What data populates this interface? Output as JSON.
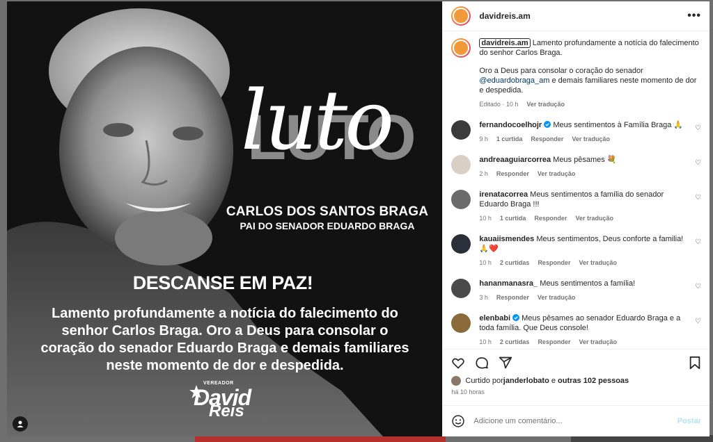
{
  "post": {
    "headline_bg": "LUTO",
    "headline_script": "luto",
    "name": "CARLOS DOS SANTOS BRAGA",
    "subname": "PAI DO SENADOR EDUARDO BRAGA",
    "rip": "DESCANSE EM PAZ!",
    "message": "Lamento profundamente a notícia do falecimento do senhor Carlos Braga. Oro a Deus para consolar o coração do senador Eduardo Braga e demais familiares neste momento de dor e despedida.",
    "logo_small": "VEREADOR",
    "logo_line1": "David",
    "logo_line2": "Reis"
  },
  "header": {
    "username": "davidreis.am",
    "more": "•••"
  },
  "caption": {
    "username": "davidreis.am",
    "text1": " Lamento profundamente a notícia do falecimento do senhor Carlos Braga.",
    "text2a": "Oro a Deus para consolar o coração do senador ",
    "mention": "@eduardobraga_am",
    "text2b": " e demais familiares neste momento de dor e despedida.",
    "edited": "Editado · 10 h",
    "translate": "Ver tradução"
  },
  "comments": [
    {
      "user": "fernandocoelhojr",
      "verified": true,
      "text": "Meus sentimentos à Família Braga 🙏",
      "time": "9 h",
      "likes": "1 curtida",
      "reply": "Responder",
      "translate": "Ver tradução",
      "avatar_color": "#3b3b3b"
    },
    {
      "user": "andreaaguiarcorrea",
      "verified": false,
      "text": "Meus pêsames 💐",
      "time": "2 h",
      "likes": "",
      "reply": "Responder",
      "translate": "Ver tradução",
      "avatar_color": "#d9cfc4"
    },
    {
      "user": "irenatacorrea",
      "verified": false,
      "text": "Meus sentimentos a família do senador Eduardo Braga !!!",
      "time": "10 h",
      "likes": "1 curtida",
      "reply": "Responder",
      "translate": "Ver tradução",
      "avatar_color": "#6b6b6b"
    },
    {
      "user": "kauaiismendes",
      "verified": false,
      "text": "Meus sentimentos, Deus conforte a familia! 🙏❤️",
      "time": "10 h",
      "likes": "2 curtidas",
      "reply": "Responder",
      "translate": "Ver tradução",
      "avatar_color": "#2b2f3a"
    },
    {
      "user": "hananmanasra_",
      "verified": false,
      "text": "Meus sentimentos a família!",
      "time": "3 h",
      "likes": "",
      "reply": "Responder",
      "translate": "Ver tradução",
      "avatar_color": "#4a4a4a"
    },
    {
      "user": "elenbabi",
      "verified": true,
      "text": "Meus pêsames ao senador Eduardo Braga e a toda família. Que Deus console!",
      "time": "10 h",
      "likes": "2 curtidas",
      "reply": "Responder",
      "translate": "Ver tradução",
      "avatar_color": "#8a6a3a"
    }
  ],
  "likes": {
    "prefix": "Curtido por ",
    "user": "janderlobato",
    "mid": " e ",
    "others": "outras 102 pessoas"
  },
  "timestamp": "há 10 horas",
  "composer": {
    "placeholder": "Adicione um comentário...",
    "post": "Postar"
  },
  "colors": {
    "accent": "#0095f6",
    "verified": "#0095f6",
    "heart": "#ed4956"
  }
}
